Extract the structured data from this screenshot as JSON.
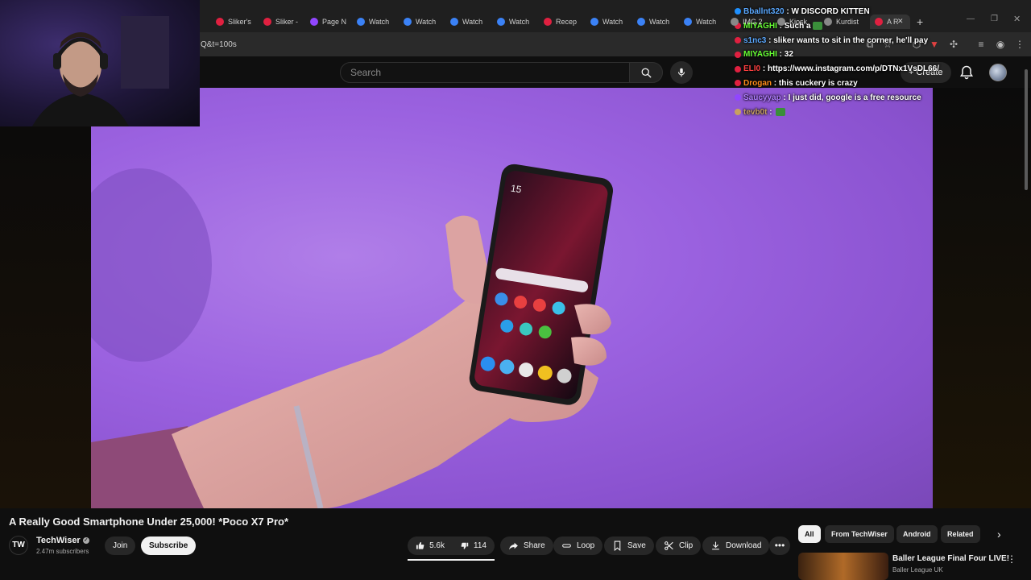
{
  "browser": {
    "tabs": [
      {
        "label": "Sliker's",
        "color": "#e02040"
      },
      {
        "label": "Sliker -",
        "color": "#e02040"
      },
      {
        "label": "Page N",
        "color": "#9146ff"
      },
      {
        "label": "Watch",
        "color": "#3b82f6"
      },
      {
        "label": "Watch",
        "color": "#3b82f6"
      },
      {
        "label": "Watch",
        "color": "#3b82f6"
      },
      {
        "label": "Watch",
        "color": "#3b82f6"
      },
      {
        "label": "Recep",
        "color": "#e02040"
      },
      {
        "label": "Watch",
        "color": "#3b82f6"
      },
      {
        "label": "Watch",
        "color": "#3b82f6"
      },
      {
        "label": "Watch",
        "color": "#3b82f6"
      },
      {
        "label": "IMG 2",
        "color": "#888888"
      },
      {
        "label": "Kiosk",
        "color": "#888888"
      },
      {
        "label": "Kurdist",
        "color": "#888888"
      },
      {
        "label": "A R",
        "color": "#e02040"
      }
    ],
    "url": "Q&t=100s",
    "new_tab_symbol": "+"
  },
  "youtube": {
    "search_placeholder": "Search",
    "create_label": "Create"
  },
  "chat": [
    {
      "user": "Bballnt320",
      "message": "W DISCORD KITTEN",
      "user_color": "#5aa8ff",
      "badge_color": "#1e90ff"
    },
    {
      "user": "MIYAGHI",
      "message": "Such a",
      "user_color": "#66ff33",
      "badge_color": "#e02040",
      "emote": true
    },
    {
      "user": "s1nc3",
      "message": "sliker wants to sit in the corner, he'll pay",
      "user_color": "#5aa8ff",
      "badge_color": "#e02040"
    },
    {
      "user": "MIYAGHI",
      "message": "32",
      "user_color": "#66ff33",
      "badge_color": "#e02040"
    },
    {
      "user": "ELI0",
      "message": "https://www.instagram.com/p/DTNx1VsDL66/",
      "user_color": "#ff4040",
      "badge_color": "#e02040"
    },
    {
      "user": "Drogan",
      "message": "this cuckery is crazy",
      "user_color": "#ff8c1a",
      "badge_color": "#e02040"
    },
    {
      "user": "Saucyyap",
      "message": "I just did, google is a free resource",
      "user_color": "#b07cff",
      "badge_color": "#9146ff"
    },
    {
      "user": "tevb0t",
      "message": "",
      "user_color": "#c8a060",
      "badge_color": "#c8a060",
      "emote": true
    }
  ],
  "video": {
    "title": "A Really Good Smartphone Under 25,000! *Poco X7 Pro*",
    "channel": {
      "avatar_text": "TW",
      "name": "TechWiser",
      "verified_icon": "verified-check-icon",
      "subscribers": "2.47m subscribers"
    },
    "buttons": {
      "join": "Join",
      "subscribe": "Subscribe",
      "likes": "5.6k",
      "dislikes": "114",
      "share": "Share",
      "loop": "Loop",
      "save": "Save",
      "clip": "Clip",
      "download": "Download"
    },
    "phone_screen_text": "15"
  },
  "sidebar": {
    "chips": [
      "All",
      "From TechWiser",
      "Android",
      "Related"
    ],
    "recommended": {
      "title": "Baller League Final Four LIVE!",
      "channel": "Baller League UK"
    }
  }
}
